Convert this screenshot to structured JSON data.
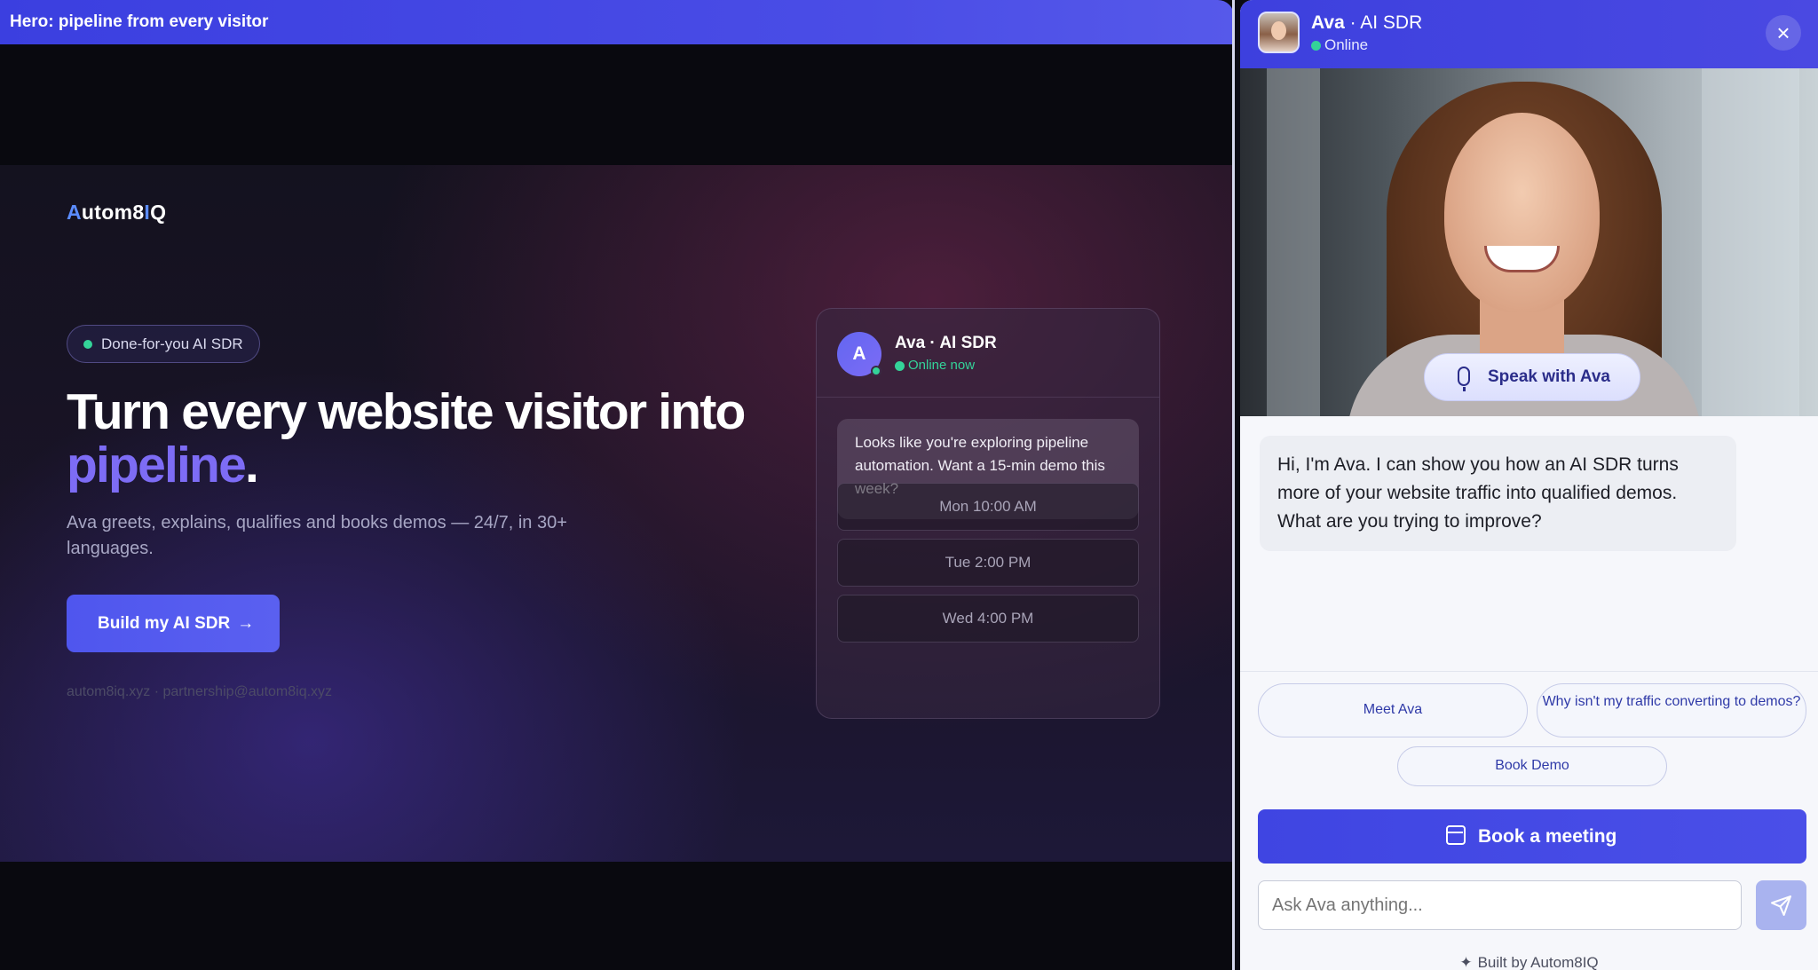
{
  "hero_topbar": {
    "title": "Hero: pipeline from every visitor"
  },
  "hero": {
    "logo": {
      "prefix": "A",
      "middle": "utom8",
      "accent": "I",
      "suffix": "Q"
    },
    "badge": "Done-for-you AI SDR",
    "headline_line1": "Turn every website visitor into",
    "headline_accent": "pipeline",
    "headline_period": ".",
    "subhead": "Ava greets, explains, qualifies and books demos — 24/7, in 30+ languages.",
    "cta_label": "Build my AI SDR",
    "cta_arrow": "→",
    "footer_links": "autom8iq.xyz · partnership@autom8iq.xyz"
  },
  "demo_card": {
    "avatar_letter": "A",
    "name": "Ava · AI SDR",
    "status": "Online now",
    "message": "Looks like you're exploring pipeline automation. Want a 15-min demo this week?",
    "slots": [
      "Mon 10:00 AM",
      "Tue 2:00 PM",
      "Wed 4:00 PM"
    ]
  },
  "chat_widget": {
    "name_bold": "Ava",
    "name_rest": " · AI SDR",
    "status": "Online",
    "close_icon": "×",
    "speak_label": "Speak with Ava",
    "ava_message": "Hi, I'm Ava. I can show you how an AI SDR turns more of your website traffic into qualified demos. What are you trying to improve?",
    "chips": {
      "meet": "Meet Ava",
      "why": "Why isn't my traffic converting to demos?",
      "book": "Book Demo"
    },
    "book_meeting_label": "Book a meeting",
    "input_placeholder": "Ask Ava anything...",
    "built_by": "Built by  Autom8IQ",
    "built_by_icon": "✦"
  },
  "colors": {
    "accent": "#4a4de6",
    "accent_purple": "#7d6cf5",
    "online_green": "#34d399"
  }
}
